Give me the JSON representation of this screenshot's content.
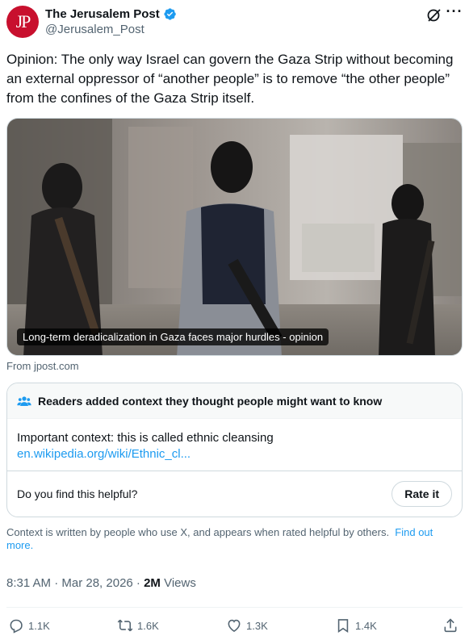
{
  "account": {
    "avatar_text": "JP",
    "name": "The Jerusalem Post",
    "handle": "@Jerusalem_Post",
    "verified_color": "#1d9bf0"
  },
  "tweet": {
    "text": "Opinion: The only way Israel can govern the Gaza Strip without becoming an external oppressor of “another people” is to remove “the other people” from the confines of the Gaza Strip itself."
  },
  "card": {
    "caption": "Long-term deradicalization in Gaza faces major hurdles - opinion",
    "source": "From jpost.com"
  },
  "community_note": {
    "header": "Readers added context they thought people might want to know",
    "context": "Important context: this is called ethnic cleansing",
    "link": "en.wikipedia.org/wiki/Ethnic_cl...",
    "question": "Do you find this helpful?",
    "rate_label": "Rate it",
    "disclaimer": "Context is written by people who use X, and appears when rated helpful by others.",
    "find_out_more": "Find out more."
  },
  "meta": {
    "time_date": "8:31 AM · Mar 28, 2026 · ",
    "views_count": "2M",
    "views_label": " Views"
  },
  "actions": {
    "replies": "1.1K",
    "reposts": "1.6K",
    "likes": "1.3K",
    "bookmarks": "1.4K"
  },
  "icons": [
    "verified-badge-icon",
    "grok-icon",
    "more-icon",
    "people-icon",
    "reply-icon",
    "repost-icon",
    "like-icon",
    "bookmark-icon",
    "share-icon"
  ]
}
